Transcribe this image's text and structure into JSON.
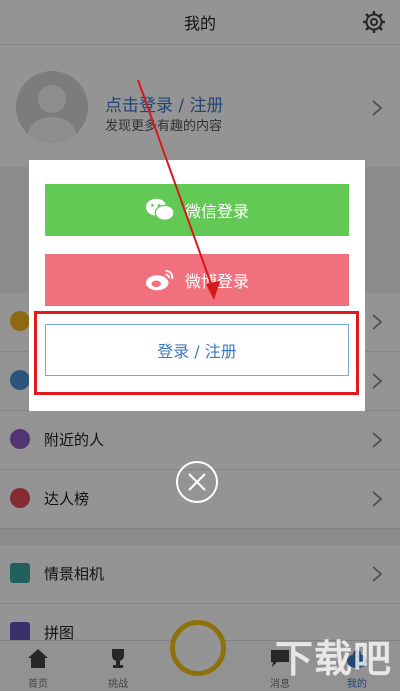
{
  "header": {
    "title": "我的"
  },
  "profile": {
    "login_text": "点击登录 / 注册",
    "subtitle": "发现更多有趣的内容"
  },
  "menu": [
    {
      "label": "",
      "icon": "coin-icon",
      "color": "#f5b321"
    },
    {
      "label": "",
      "icon": "user-icon",
      "color": "#4a8fd9"
    },
    {
      "label": "附近的人",
      "icon": "location-icon",
      "color": "#8b5bc7"
    },
    {
      "label": "达人榜",
      "icon": "star-icon",
      "color": "#e34a5b"
    },
    {
      "label": "情景相机",
      "icon": "camera-icon",
      "color": "#3aa6a0"
    },
    {
      "label": "拼图",
      "icon": "puzzle-icon",
      "color": "#5d55b8"
    }
  ],
  "tabs": [
    {
      "label": "首页",
      "icon": "home-icon"
    },
    {
      "label": "挑战",
      "icon": "trophy-icon"
    },
    {
      "label": "消息",
      "icon": "message-icon"
    },
    {
      "label": "我的",
      "icon": "profile-icon"
    }
  ],
  "dialog": {
    "wechat_label": "微信登录",
    "weibo_label": "微博登录",
    "account_label": "登录 / 注册"
  },
  "watermark": "下载吧",
  "colors": {
    "accent": "#3b79c8",
    "wechat": "#62c954",
    "weibo": "#f0707d",
    "highlight": "#e11b1b"
  }
}
